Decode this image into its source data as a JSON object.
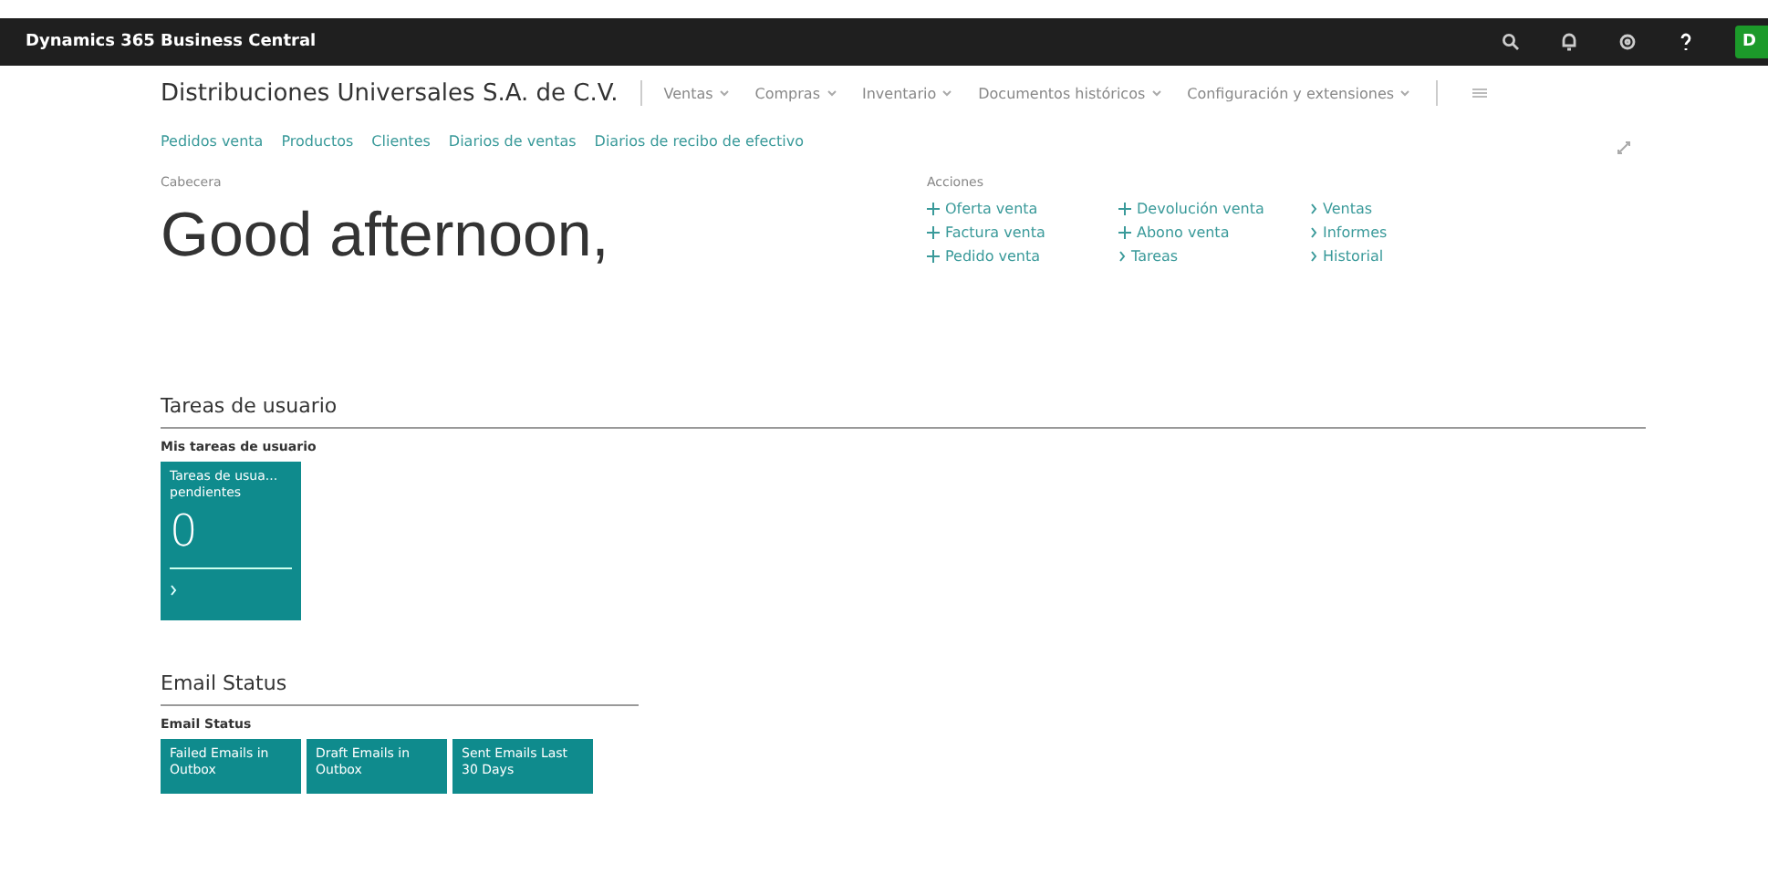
{
  "app_bar": {
    "title": "Dynamics 365 Business Central",
    "avatar": "D"
  },
  "company": "Distribuciones Universales S.A. de C.V.",
  "menu": [
    "Ventas",
    "Compras",
    "Inventario",
    "Documentos históricos",
    "Configuración y extensiones"
  ],
  "nav_links": [
    "Pedidos venta",
    "Productos",
    "Clientes",
    "Diarios de ventas",
    "Diarios de recibo de efectivo"
  ],
  "headline": {
    "caption": "Cabecera",
    "greeting": "Good afternoon,"
  },
  "actions": {
    "caption": "Acciones",
    "columns": [
      [
        {
          "kind": "new",
          "label": "Oferta venta"
        },
        {
          "kind": "new",
          "label": "Factura venta"
        },
        {
          "kind": "new",
          "label": "Pedido venta"
        }
      ],
      [
        {
          "kind": "new",
          "label": "Devolución venta"
        },
        {
          "kind": "new",
          "label": "Abono venta"
        },
        {
          "kind": "group",
          "label": "Tareas"
        }
      ],
      [
        {
          "kind": "group",
          "label": "Ventas"
        },
        {
          "kind": "group",
          "label": "Informes"
        },
        {
          "kind": "group",
          "label": "Historial"
        }
      ]
    ]
  },
  "sections": [
    {
      "title": "Tareas de usuario",
      "wide": true,
      "group": "Mis tareas de usuario",
      "tiles": [
        {
          "label": "Tareas de usua... pendientes",
          "value": "0"
        }
      ]
    },
    {
      "title": "Email Status",
      "wide": false,
      "group": "Email Status",
      "tiles": [
        {
          "label": "Failed Emails in Outbox"
        },
        {
          "label": "Draft Emails in Outbox"
        },
        {
          "label": "Sent Emails Last 30 Days"
        }
      ]
    }
  ]
}
